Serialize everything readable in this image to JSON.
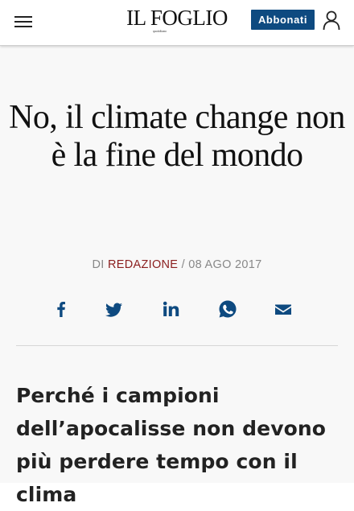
{
  "header": {
    "logo_text": "IL FOGLIO",
    "logo_tagline": "quotidiano",
    "subscribe_label": "Abbonati",
    "menu_icon": "hamburger-menu-icon",
    "user_icon": "user-account-icon",
    "accent_color": "#0e4a80"
  },
  "article": {
    "title": "No, il climate change non è la fine del mondo",
    "byline_prefix": "DI",
    "author": "REDAZIONE",
    "date": "/ 08 AGO 2017",
    "author_color": "#8b1e1e",
    "subtitle": "Perché i campioni dell’apocalisse non devono più perdere tempo con il clima"
  },
  "share": {
    "icons": [
      "facebook-icon",
      "twitter-icon",
      "linkedin-icon",
      "whatsapp-icon",
      "email-icon"
    ],
    "color": "#0e4a80"
  }
}
